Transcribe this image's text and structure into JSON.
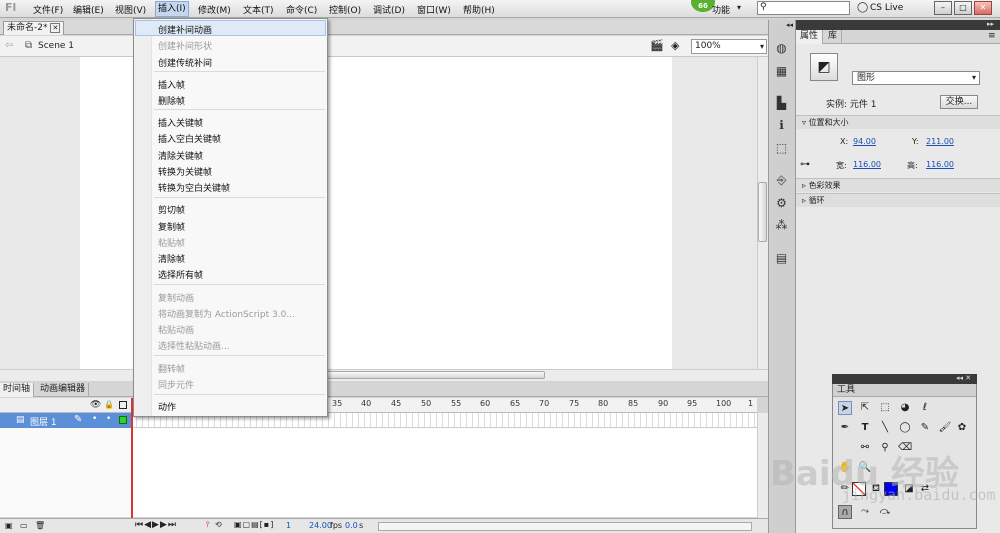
{
  "app": {
    "logo": "Fl"
  },
  "menubar": {
    "items": [
      "文件(F)",
      "编辑(E)",
      "视图(V)",
      "插入(I)",
      "修改(M)",
      "文本(T)",
      "命令(C)",
      "控制(O)",
      "调试(D)",
      "窗口(W)",
      "帮助(H)"
    ],
    "workspace_label": "功能",
    "badge": "66",
    "cslive": "CS Live"
  },
  "document": {
    "tab_title": "未命名-2*",
    "scene": "Scene 1",
    "zoom": "100%"
  },
  "context_menu": {
    "items": [
      {
        "label": "创建补间动画",
        "disabled": false
      },
      {
        "label": "创建补间形状",
        "disabled": true
      },
      {
        "label": "创建传统补间",
        "disabled": false
      },
      {
        "label": "插入帧",
        "disabled": false
      },
      {
        "label": "删除帧",
        "disabled": false
      },
      {
        "label": "插入关键帧",
        "disabled": false
      },
      {
        "label": "插入空白关键帧",
        "disabled": false
      },
      {
        "label": "清除关键帧",
        "disabled": false
      },
      {
        "label": "转换为关键帧",
        "disabled": false
      },
      {
        "label": "转换为空白关键帧",
        "disabled": false
      },
      {
        "label": "剪切帧",
        "disabled": false
      },
      {
        "label": "复制帧",
        "disabled": false
      },
      {
        "label": "粘贴帧",
        "disabled": true
      },
      {
        "label": "清除帧",
        "disabled": false
      },
      {
        "label": "选择所有帧",
        "disabled": false
      },
      {
        "label": "复制动画",
        "disabled": true
      },
      {
        "label": "将动画复制为 ActionScript 3.0...",
        "disabled": true
      },
      {
        "label": "粘贴动画",
        "disabled": true
      },
      {
        "label": "选择性粘贴动画...",
        "disabled": true
      },
      {
        "label": "翻转帧",
        "disabled": true
      },
      {
        "label": "同步元件",
        "disabled": true
      },
      {
        "label": "动作",
        "disabled": false
      }
    ]
  },
  "timeline": {
    "tabs": [
      "时间轴",
      "动画编辑器"
    ],
    "layer_name": "图层 1",
    "ruler": [
      "35",
      "40",
      "45",
      "50",
      "55",
      "60",
      "65",
      "70",
      "75",
      "80",
      "85",
      "90",
      "95",
      "100",
      "1"
    ],
    "status": {
      "frame": "1",
      "fps": "24.00",
      "fps_unit": "fps",
      "time": "0.0",
      "time_unit": "s"
    }
  },
  "properties": {
    "tabs": [
      "属性",
      "库"
    ],
    "symbol_type": "图形",
    "instance_label": "实例: 元件 1",
    "swap_label": "交换...",
    "sections": [
      "位置和大小",
      "色彩效果",
      "循环"
    ],
    "x_label": "X:",
    "x_value": "94.00",
    "y_label": "Y:",
    "y_value": "211.00",
    "w_label": "宽:",
    "w_value": "116.00",
    "h_label": "高:",
    "h_value": "116.00"
  },
  "tools_panel": {
    "title": "工具"
  },
  "watermark": {
    "brand": "Baidu 经验",
    "url": "jingyan.baidu.com"
  }
}
